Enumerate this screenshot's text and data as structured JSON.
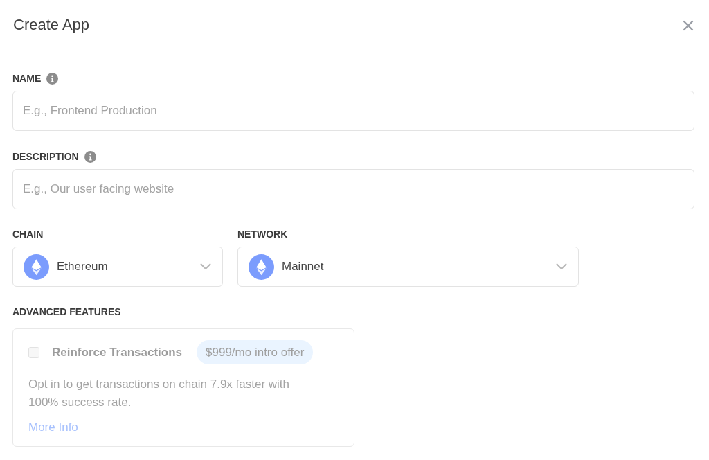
{
  "dialog": {
    "title": "Create App"
  },
  "fields": [
    {
      "label": "NAME",
      "info": true,
      "placeholder": "E.g., Frontend Production"
    },
    {
      "label": "DESCRIPTION",
      "info": true,
      "placeholder": "E.g., Our user facing website"
    }
  ],
  "selects": [
    {
      "label": "CHAIN",
      "value": "Ethereum"
    },
    {
      "label": "NETWORK",
      "value": "Mainnet"
    }
  ],
  "advanced_features": {
    "heading": "ADVANCED FEATURES",
    "items": [
      {
        "title": "Reinforce Transactions",
        "checked": false,
        "disabled": true,
        "badge": "$999/mo intro offer",
        "description": "Opt in to get transactions on chain 7.9x faster with 100% success rate.",
        "link": "More Info"
      }
    ]
  }
}
